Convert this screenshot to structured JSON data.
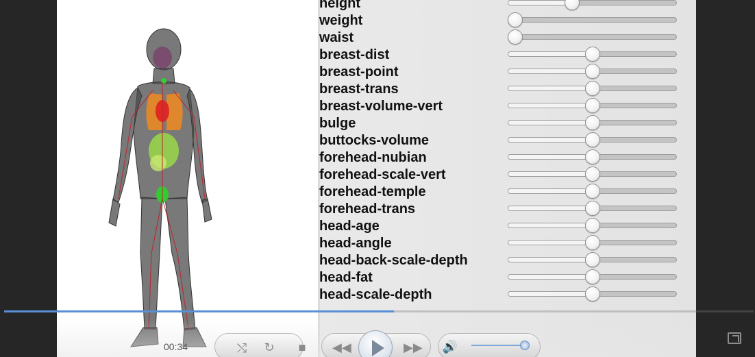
{
  "modifiers": [
    {
      "label": "height",
      "value": 0.37
    },
    {
      "label": "weight",
      "value": 0.0
    },
    {
      "label": "waist",
      "value": 0.0
    },
    {
      "label": "breast-dist",
      "value": 0.5
    },
    {
      "label": "breast-point",
      "value": 0.5
    },
    {
      "label": "breast-trans",
      "value": 0.5
    },
    {
      "label": "breast-volume-vert",
      "value": 0.5
    },
    {
      "label": "bulge",
      "value": 0.5
    },
    {
      "label": "buttocks-volume",
      "value": 0.5
    },
    {
      "label": "forehead-nubian",
      "value": 0.5
    },
    {
      "label": "forehead-scale-vert",
      "value": 0.5
    },
    {
      "label": "forehead-temple",
      "value": 0.5
    },
    {
      "label": "forehead-trans",
      "value": 0.5
    },
    {
      "label": "head-age",
      "value": 0.5
    },
    {
      "label": "head-angle",
      "value": 0.5
    },
    {
      "label": "head-back-scale-depth",
      "value": 0.5
    },
    {
      "label": "head-fat",
      "value": 0.5
    },
    {
      "label": "head-scale-depth",
      "value": 0.5
    }
  ],
  "player": {
    "time": "00:34",
    "progress": 0.52,
    "volume": 0.9,
    "icons": [
      "shuffle-icon",
      "repeat-icon",
      "stop-icon",
      "rewind-icon",
      "play-icon",
      "fast-forward-icon",
      "volume-icon",
      "switch-to-library-icon"
    ]
  },
  "colors": {
    "organs_lungs": "#f08a1e",
    "organs_heart": "#e02020",
    "organs_intestines": "#9ad84a",
    "organs_bladder": "#2ed12e",
    "body_shell": "#5a5a5a",
    "progress": "#5a8fd6"
  }
}
